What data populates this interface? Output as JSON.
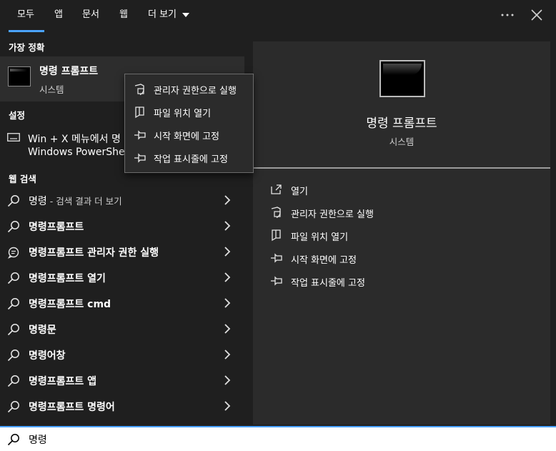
{
  "tabs": [
    {
      "label": "모두"
    },
    {
      "label": "앱"
    },
    {
      "label": "문서"
    },
    {
      "label": "웹"
    },
    {
      "label": "더 보기"
    }
  ],
  "left": {
    "best_match_header": "가장 정확",
    "best_match": {
      "title": "명령 프롬프트",
      "subtitle": "시스템"
    },
    "settings_header": "설정",
    "settings_item": {
      "line1": "Win + X 메뉴에서 명",
      "line2": "Windows PowerShe"
    },
    "web_header": "웹 검색",
    "web_results": [
      {
        "label": "명령",
        "sub": " - 검색 결과 더 보기"
      },
      {
        "label": "명령프롬프트",
        "sub": ""
      },
      {
        "label": "명령프롬프트 관리자 권한 실행",
        "sub": ""
      },
      {
        "label": "명령프롬프트 열기",
        "sub": ""
      },
      {
        "label": "명령프롬프트 cmd",
        "sub": ""
      },
      {
        "label": "명령문",
        "sub": ""
      },
      {
        "label": "명령어창",
        "sub": ""
      },
      {
        "label": "명령프롬프트 앱",
        "sub": ""
      },
      {
        "label": "명령프롬프트 명령어",
        "sub": ""
      }
    ]
  },
  "context_menu": [
    {
      "label": "관리자 권한으로 실행",
      "icon": "shield-icon"
    },
    {
      "label": "파일 위치 열기",
      "icon": "file-location-icon"
    },
    {
      "label": "시작 화면에 고정",
      "icon": "pin-icon"
    },
    {
      "label": "작업 표시줄에 고정",
      "icon": "pin-icon"
    }
  ],
  "right": {
    "title": "명령 프롬프트",
    "subtitle": "시스템",
    "actions": [
      {
        "label": "열기",
        "icon": "open-icon"
      },
      {
        "label": "관리자 권한으로 실행",
        "icon": "shield-icon"
      },
      {
        "label": "파일 위치 열기",
        "icon": "file-location-icon"
      },
      {
        "label": "시작 화면에 고정",
        "icon": "pin-icon"
      },
      {
        "label": "작업 표시줄에 고정",
        "icon": "pin-icon"
      }
    ]
  },
  "search": {
    "value": "명령",
    "placeholder": ""
  },
  "colors": {
    "accent": "#4aa3ff",
    "background": "#1f1f1f",
    "panel": "#2b2b2b"
  }
}
